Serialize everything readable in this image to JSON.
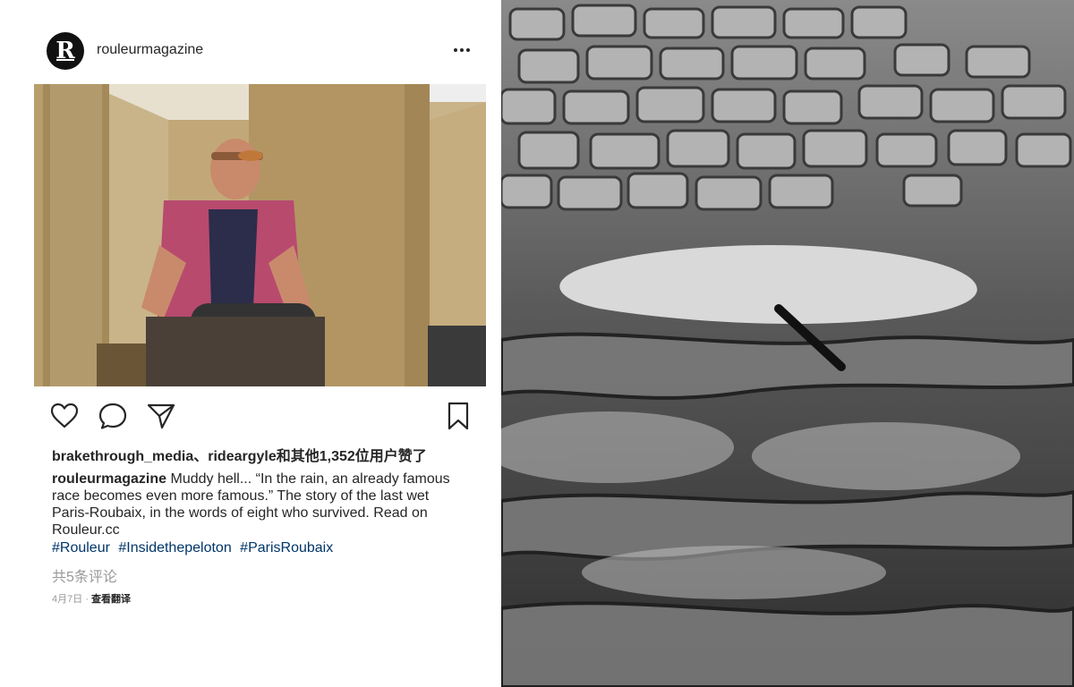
{
  "post": {
    "username": "rouleurmagazine",
    "avatar_letter": "R",
    "likes_text": "brakethrough_media、rideargyle和其他1,352位用户赞了",
    "caption": {
      "username": "rouleurmagazine",
      "text": "Muddy hell... “In the rain, an already famous race becomes even more famous.” The story of the last wet Paris-Roubaix, in the words of eight who survived. Read on Rouleur.cc"
    },
    "hashtags": [
      "#Rouleur",
      "#Insidethepeloton",
      "#ParisRoubaix"
    ],
    "comments_link": "共5条评论",
    "date": "4月7日",
    "separator": "·",
    "translate_link": "查看翻译"
  },
  "icons": {
    "more": "more-options-icon",
    "like": "heart-icon",
    "comment": "comment-icon",
    "share": "send-icon",
    "save": "bookmark-icon"
  },
  "colors": {
    "text": "#262626",
    "hashtag": "#003569",
    "muted": "#999999"
  }
}
